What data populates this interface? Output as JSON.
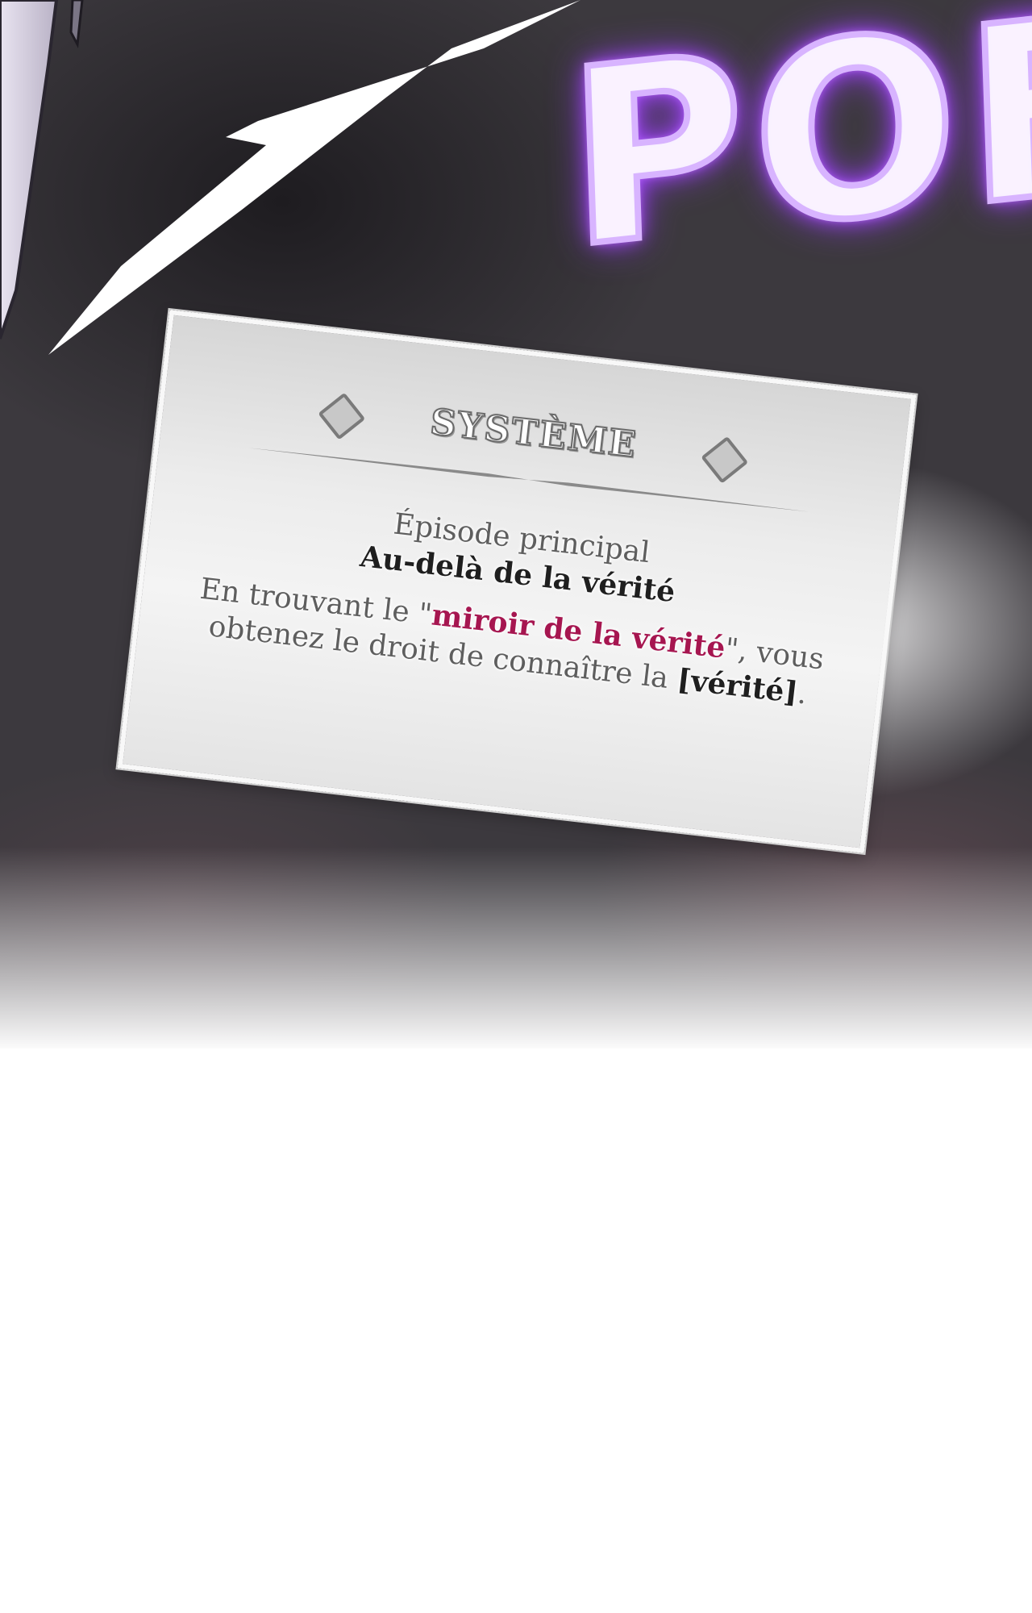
{
  "sfx": {
    "text": "POF",
    "glow_color": "#a84cff"
  },
  "system_panel": {
    "title": "SYSTÈME",
    "episode_label": "Épisode principal",
    "episode_name": "Au-delà de la vérité",
    "message": {
      "part1": "En trouvant le \"",
      "highlight": "miroir de la vérité",
      "part2": "\", vous obtenez le droit de connaître la ",
      "emphasis": "[vérité]",
      "part3": "."
    },
    "accent_color": "#a61650"
  }
}
